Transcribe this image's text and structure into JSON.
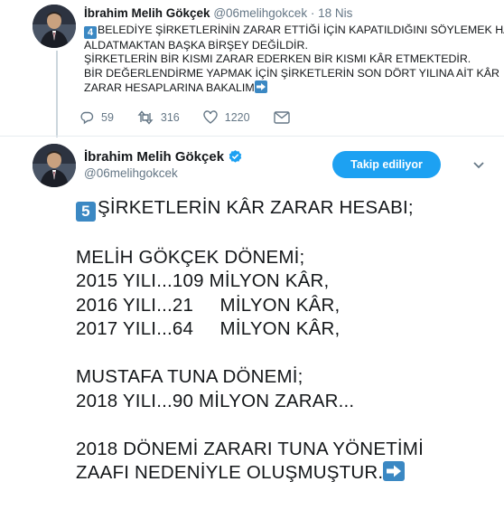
{
  "previous_tweet": {
    "author_name": "İbrahim Melih Gökçek",
    "handle": "@06melihgokcek",
    "separator": "·",
    "time": "18 Nis",
    "lines": [
      {
        "keycap": "4",
        "text": "BELEDİYE ŞİRKETLERİNİN ZARAR ETTİĞİ İÇİN KAPATILDIĞINI SÖYLEMEK HALKI"
      },
      {
        "text": "ALDATMAKTAN BAŞKA BİRŞEY DEĞİLDİR."
      },
      {
        "text": "ŞİRKETLERİN BİR KISMI ZARAR EDERKEN BİR KISMI KÂR ETMEKTEDİR."
      },
      {
        "text": "BİR DEĞERLENDİRME YAPMAK İÇİN ŞİRKETLERİN SON DÖRT YILINA AİT KÂR"
      },
      {
        "text": "ZARAR HESAPLARINA BAKALIM",
        "arrow_icon": "right-arrow-emoji"
      }
    ],
    "reply_count": "59",
    "retweet_count": "316",
    "like_count": "1220"
  },
  "main_tweet": {
    "author_name": "İbrahim Melih Gökçek",
    "verified": true,
    "handle": "@06melihgokcek",
    "follow_button_label": "Takip ediliyor",
    "keycap": "5",
    "title": "ŞİRKETLERİN KÂR ZARAR HESABI;",
    "period1_header": "MELİH GÖKÇEK DÖNEMİ;",
    "line_2015": "2015 YILI...109 MİLYON KÂR,",
    "line_2016": "2016 YILI...21     MİLYON KÂR,",
    "line_2017": "2017 YILI...64     MİLYON KÂR,",
    "period2_header": "MUSTAFA TUNA DÖNEMİ;",
    "line_2018": "2018 YILI...90 MİLYON ZARAR...",
    "conclusion_line1": "2018 DÖNEMİ ZARARI TUNA YÖNETİMİ",
    "conclusion_line2": "ZAAFI NEDENİYLE OLUŞMUŞTUR.",
    "arrow_icon": "right-arrow-emoji"
  },
  "colors": {
    "accent": "#1da1f2",
    "keycap": "#3b88c3",
    "muted": "#657786",
    "text": "#14171a"
  }
}
